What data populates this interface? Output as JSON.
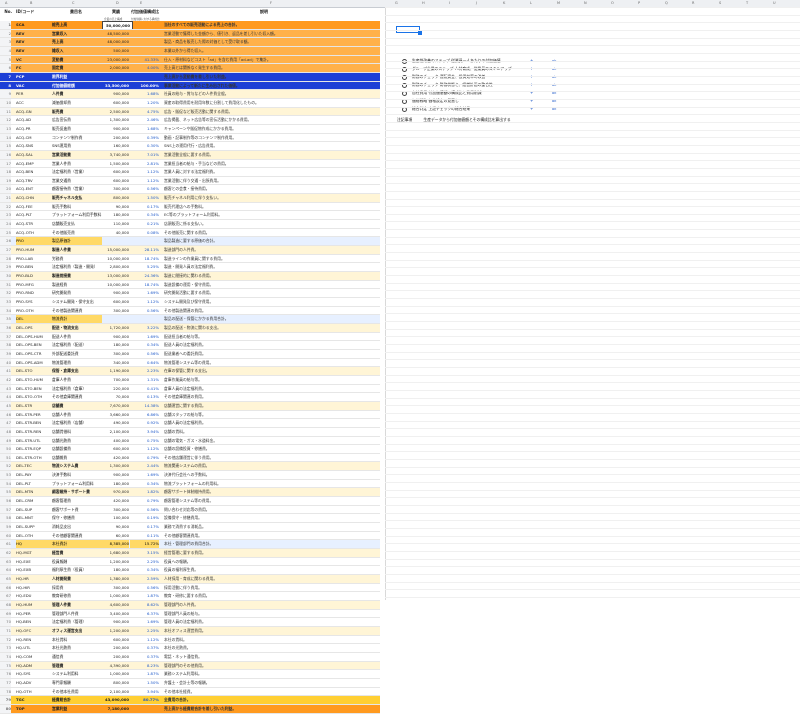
{
  "column_letters": [
    "A",
    "B",
    "C",
    "D",
    "E",
    "F",
    "G",
    "H",
    "I",
    "J",
    "K",
    "L",
    "M",
    "N",
    "O",
    "P",
    "Q",
    "R",
    "S",
    "T",
    "U"
  ],
  "headers": {
    "no": "No.",
    "code": "ID/コード",
    "name": "費目名",
    "value": "実績",
    "ratio": "付加価値構成比",
    "desc": "説明"
  },
  "subheaders": {
    "value_note": "企業の売上構成",
    "ratio_note": "付加価値に対する構成比"
  },
  "rows": [
    {
      "no": "1",
      "code": "SCA",
      "name": "総売上高",
      "value": "50,000,000",
      "ratio": "",
      "desc": "当社のすべての販売活動による売上の合計。",
      "style": "top"
    },
    {
      "no": "2",
      "code": "REV",
      "name": "営業収入",
      "value": "48,500,000",
      "ratio": "",
      "desc": "営業活動で獲得した金額から、値引き、返品を差し引いた収入額。",
      "style": "sales"
    },
    {
      "no": "3",
      "code": "REV",
      "name": "売上高",
      "value": "48,000,000",
      "ratio": "",
      "desc": "製品・商品を販売した際の対価として受け取る額。",
      "style": "sales"
    },
    {
      "no": "4",
      "code": "REV",
      "name": "雑収入",
      "value": "500,000",
      "ratio": "",
      "desc": "本業以外から得た収入。",
      "style": "sales"
    },
    {
      "no": "5",
      "code": "VC",
      "name": "変動費",
      "value": "23,000,000",
      "ratio": "41.33%",
      "desc": "仕入・原材料などコスト「ad」を含む費用「ad-ad」で集計。",
      "style": "sales"
    },
    {
      "no": "6",
      "code": "FC",
      "name": "固定費",
      "value": "2,000,000",
      "ratio": "4.00%",
      "desc": "売上高とは関係なく発生する費用。",
      "style": "sales"
    },
    {
      "no": "7",
      "code": "PCP",
      "name": "限界利益",
      "value": "",
      "ratio": "",
      "desc": "売上高から変動費を差し引いた利益。",
      "style": "blue"
    },
    {
      "no": "8",
      "code": "VAC",
      "name": "付加価値総額",
      "value": "33,500,000",
      "ratio": "100.00%",
      "desc": "事業活動によって新たに生み出された価値。",
      "style": "blue"
    },
    {
      "no": "9",
      "code": "PER",
      "name": "人件費",
      "value": "900,000",
      "ratio": "1.68%",
      "desc": "社員の給与・賞与などの人件費全般。",
      "style": "cat"
    },
    {
      "no": "10",
      "code": "ACC",
      "name": "減価償却費",
      "value": "600,000",
      "ratio": "1.20%",
      "desc": "資産の取得費用を耐用年数に分割して費用化したもの。",
      "style": "sub2"
    },
    {
      "no": "11",
      "code": "ACQ-GN",
      "name": "販売費",
      "value": "2,500,000",
      "ratio": "4.75%",
      "desc": "広告・販促など販売活動に関する費用。",
      "style": "cat"
    },
    {
      "no": "12",
      "code": "ACQ-AD",
      "name": "広告宣伝費",
      "value": "1,300,000",
      "ratio": "2.46%",
      "desc": "広告掲載、ネット広告等の宣伝活動にかかる費用。",
      "style": "sub2"
    },
    {
      "no": "13",
      "code": "ACQ-PR",
      "name": "販売促進費",
      "value": "900,000",
      "ratio": "1.68%",
      "desc": "キャンペーンや販促物作成にかかる費用。",
      "style": "sub2"
    },
    {
      "no": "14",
      "code": "ACQ-CM",
      "name": "コンテンツ制作費",
      "value": "200,000",
      "ratio": "0.39%",
      "desc": "動画・記事制作等のコンテンツ制作費用。",
      "style": "sub2"
    },
    {
      "no": "15",
      "code": "ACQ-SNS",
      "name": "SNS運用費",
      "value": "160,000",
      "ratio": "0.30%",
      "desc": "SNS上の運用代行・広告費用。",
      "style": "sub2"
    },
    {
      "no": "16",
      "code": "ACQ-SAL",
      "name": "営業活動費",
      "value": "3,740,000",
      "ratio": "7.01%",
      "desc": "営業活動全般に要する費用。",
      "style": "cat"
    },
    {
      "no": "17",
      "code": "ACQ-EMP",
      "name": "営業人件費",
      "value": "1,500,000",
      "ratio": "2.81%",
      "desc": "営業担当者の給与・手当などの費用。",
      "style": "sub2"
    },
    {
      "no": "18",
      "code": "ACQ-BEN",
      "name": "法定福利費（営業）",
      "value": "600,000",
      "ratio": "1.12%",
      "desc": "営業人員に対する法定福利費。",
      "style": "sub2"
    },
    {
      "no": "19",
      "code": "ACQ-TRV",
      "name": "営業交通費",
      "value": "600,000",
      "ratio": "1.12%",
      "desc": "営業活動に伴う交通・出張費用。",
      "style": "sub2"
    },
    {
      "no": "20",
      "code": "ACQ-ENT",
      "name": "顧客接待費（営業）",
      "value": "300,000",
      "ratio": "0.56%",
      "desc": "顧客との会食・接待費用。",
      "style": "sub2"
    },
    {
      "no": "21",
      "code": "ACQ-CHN",
      "name": "販売チャネル支払",
      "value": "800,000",
      "ratio": "1.50%",
      "desc": "販売チャネル利用に伴う支払い。",
      "style": "cat"
    },
    {
      "no": "22",
      "code": "ACQ-FEE",
      "name": "販売手数料",
      "value": "90,000",
      "ratio": "0.17%",
      "desc": "販売代理店への手数料。",
      "style": "sub2"
    },
    {
      "no": "23",
      "code": "ACQ-PLT",
      "name": "プラットフォーム利用手数料",
      "value": "180,000",
      "ratio": "0.34%",
      "desc": "EC等のプラットフォーム利用料。",
      "style": "sub2"
    },
    {
      "no": "24",
      "code": "ACQ-STR",
      "name": "店舗販売支払",
      "value": "110,000",
      "ratio": "0.21%",
      "desc": "店頭販売に係る支払い。",
      "style": "sub2"
    },
    {
      "no": "25",
      "code": "ACQ-OTH",
      "name": "その他販売費",
      "value": "40,000",
      "ratio": "0.08%",
      "desc": "その他販売に関する費用。",
      "style": "sub2"
    },
    {
      "no": "26",
      "code": "PRO",
      "name": "製品原価計",
      "value": "",
      "ratio": "",
      "desc": "製品製造に要する原価の合計。",
      "style": "gold"
    },
    {
      "no": "27",
      "code": "PRO-HUM",
      "name": "製造人件費",
      "value": "15,000,000",
      "ratio": "28.11%",
      "desc": "製造部門の人件費。",
      "style": "cat"
    },
    {
      "no": "28",
      "code": "PRO-LAB",
      "name": "労務費",
      "value": "10,000,000",
      "ratio": "18.74%",
      "desc": "製造ラインの作業員に関する費用。",
      "style": "sub2"
    },
    {
      "no": "29",
      "code": "PRO-BEN",
      "name": "法定福利費（製造・開発）",
      "value": "2,800,000",
      "ratio": "5.25%",
      "desc": "製造・開発人員の法定福利費。",
      "style": "sub2"
    },
    {
      "no": "30",
      "code": "PRO-BLD",
      "name": "製造間接費",
      "value": "13,000,000",
      "ratio": "24.36%",
      "desc": "製造に間接的に関わる費用。",
      "style": "cat"
    },
    {
      "no": "31",
      "code": "PRO-MFG",
      "name": "製造経費",
      "value": "10,000,000",
      "ratio": "18.74%",
      "desc": "製造設備の運用・保守費用。",
      "style": "sub2"
    },
    {
      "no": "32",
      "code": "PRO-RND",
      "name": "研究開発費",
      "value": "900,000",
      "ratio": "1.69%",
      "desc": "研究開発活動に要する費用。",
      "style": "sub2"
    },
    {
      "no": "33",
      "code": "PRO-SYS",
      "name": "システム開発・保守支出",
      "value": "600,000",
      "ratio": "1.12%",
      "desc": "システム開発及び保守費用。",
      "style": "sub2"
    },
    {
      "no": "34",
      "code": "PRO-OTH",
      "name": "その他製造関連費",
      "value": "300,000",
      "ratio": "0.56%",
      "desc": "その他製造関連の費用。",
      "style": "sub2"
    },
    {
      "no": "35",
      "code": "DEL",
      "name": "物流費計",
      "value": "",
      "ratio": "",
      "desc": "製品の配送・保管にかかる費用合計。",
      "style": "gold"
    },
    {
      "no": "36",
      "code": "DEL-OPS",
      "name": "配送・物流支出",
      "value": "1,720,000",
      "ratio": "3.22%",
      "desc": "製品の配送・物流に関わる支出。",
      "style": "cat"
    },
    {
      "no": "37",
      "code": "DEL-OPS-HUM",
      "name": "配送人件費",
      "value": "900,000",
      "ratio": "1.69%",
      "desc": "配送担当者の給与等。",
      "style": "sub2"
    },
    {
      "no": "38",
      "code": "DEL-OPS-BEN",
      "name": "法定福利費（配送）",
      "value": "180,000",
      "ratio": "0.34%",
      "desc": "配送人員の法定福利費。",
      "style": "sub2"
    },
    {
      "no": "39",
      "code": "DEL-OPS-CTR",
      "name": "外部配送委託費",
      "value": "300,000",
      "ratio": "0.56%",
      "desc": "配送業者への委託費用。",
      "style": "sub2"
    },
    {
      "no": "40",
      "code": "DEL-OPS-ADM",
      "name": "物流管理費",
      "value": "340,000",
      "ratio": "0.64%",
      "desc": "物流管理システム等の費用。",
      "style": "sub2"
    },
    {
      "no": "41",
      "code": "DEL-STO",
      "name": "保管・倉庫支出",
      "value": "1,190,000",
      "ratio": "2.23%",
      "desc": "在庫の保管に関する支出。",
      "style": "cat"
    },
    {
      "no": "42",
      "code": "DEL-STO-HUM",
      "name": "倉庫人件費",
      "value": "700,000",
      "ratio": "1.31%",
      "desc": "倉庫作業員の給与等。",
      "style": "sub2"
    },
    {
      "no": "43",
      "code": "DEL-STO-BEN",
      "name": "法定福利費（倉庫）",
      "value": "220,000",
      "ratio": "0.41%",
      "desc": "倉庫人員の法定福利費。",
      "style": "sub2"
    },
    {
      "no": "44",
      "code": "DEL-STO-OTH",
      "name": "その他倉庫関連費",
      "value": "70,000",
      "ratio": "0.13%",
      "desc": "その他倉庫関連の費用。",
      "style": "sub2"
    },
    {
      "no": "45",
      "code": "DEL-STR",
      "name": "店舗費",
      "value": "7,670,000",
      "ratio": "14.38%",
      "desc": "店舗運営に関する費用。",
      "style": "cat"
    },
    {
      "no": "46",
      "code": "DEL-STR-PER",
      "name": "店舗人件費",
      "value": "3,660,000",
      "ratio": "6.86%",
      "desc": "店舗スタッフの給与等。",
      "style": "sub2"
    },
    {
      "no": "47",
      "code": "DEL-STR-BEN",
      "name": "法定福利費（店舗）",
      "value": "490,000",
      "ratio": "0.92%",
      "desc": "店舗人員の法定福利費。",
      "style": "sub2"
    },
    {
      "no": "48",
      "code": "DEL-STR-REN",
      "name": "店舗賃借料",
      "value": "2,100,000",
      "ratio": "3.94%",
      "desc": "店舗の賃料。",
      "style": "sub2"
    },
    {
      "no": "49",
      "code": "DEL-STR-UTL",
      "name": "店舗光熱費",
      "value": "400,000",
      "ratio": "0.75%",
      "desc": "店舗の電気・ガス・水道料金。",
      "style": "sub2"
    },
    {
      "no": "50",
      "code": "DEL-STR-EQP",
      "name": "店舗設備費",
      "value": "600,000",
      "ratio": "1.12%",
      "desc": "店舗の設備投資・修繕費。",
      "style": "sub2"
    },
    {
      "no": "51",
      "code": "DEL-STR-OTH",
      "name": "店舗雑費",
      "value": "420,000",
      "ratio": "0.79%",
      "desc": "その他店舗運営に伴う費用。",
      "style": "sub2"
    },
    {
      "no": "52",
      "code": "DEL-TEC",
      "name": "物流システム費",
      "value": "1,300,000",
      "ratio": "2.44%",
      "desc": "物流関連システムの費用。",
      "style": "cat"
    },
    {
      "no": "53",
      "code": "DEL-PAY",
      "name": "決済手数料",
      "value": "900,000",
      "ratio": "1.69%",
      "desc": "決済代行会社への手数料。",
      "style": "sub2"
    },
    {
      "no": "54",
      "code": "DEL-PLT",
      "name": "プラットフォーム利用料",
      "value": "180,000",
      "ratio": "0.34%",
      "desc": "物流プラットフォームの利用料。",
      "style": "sub2"
    },
    {
      "no": "55",
      "code": "DEL-MTN",
      "name": "顧客維持・サポート費",
      "value": "970,000",
      "ratio": "1.82%",
      "desc": "顧客サポート体制維持費用。",
      "style": "cat"
    },
    {
      "no": "56",
      "code": "DEL-CRM",
      "name": "顧客管理費",
      "value": "420,000",
      "ratio": "0.79%",
      "desc": "顧客管理システム等の費用。",
      "style": "sub2"
    },
    {
      "no": "57",
      "code": "DEL-SUP",
      "name": "顧客サポート費",
      "value": "300,000",
      "ratio": "0.56%",
      "desc": "問い合わせ対応等の費用。",
      "style": "sub2"
    },
    {
      "no": "58",
      "code": "DEL-MNT",
      "name": "保守・修繕費",
      "value": "100,000",
      "ratio": "0.19%",
      "desc": "設備保守・修繕費用。",
      "style": "sub2"
    },
    {
      "no": "59",
      "code": "DEL-SUPP",
      "name": "消耗品支出",
      "value": "90,000",
      "ratio": "0.17%",
      "desc": "業務で消費する消耗品。",
      "style": "sub2"
    },
    {
      "no": "60",
      "code": "DEL-OTH",
      "name": "その他顧客関連費",
      "value": "60,000",
      "ratio": "0.11%",
      "desc": "その他顧客関連費用。",
      "style": "sub2"
    },
    {
      "no": "61",
      "code": "HQ",
      "name": "本社費計",
      "value": "8,385,000",
      "ratio": "15.72%",
      "desc": "本社・管理部門の費用合計。",
      "style": "gold"
    },
    {
      "no": "62",
      "code": "HQ-MGT",
      "name": "経営費",
      "value": "1,680,000",
      "ratio": "3.15%",
      "desc": "経営管理に要する費用。",
      "style": "cat"
    },
    {
      "no": "63",
      "code": "HQ-EXE",
      "name": "役員報酬",
      "value": "1,200,000",
      "ratio": "2.25%",
      "desc": "役員への報酬。",
      "style": "sub2"
    },
    {
      "no": "64",
      "code": "HQ-EXB",
      "name": "福利厚生費（役員）",
      "value": "180,000",
      "ratio": "0.34%",
      "desc": "役員の福利厚生費。",
      "style": "sub2"
    },
    {
      "no": "65",
      "code": "HQ-HR",
      "name": "人材開発費",
      "value": "1,380,000",
      "ratio": "2.59%",
      "desc": "人材採用・育成に関わる費用。",
      "style": "cat"
    },
    {
      "no": "66",
      "code": "HQ-HIR",
      "name": "採用費",
      "value": "300,000",
      "ratio": "0.56%",
      "desc": "採用活動に伴う費用。",
      "style": "sub2"
    },
    {
      "no": "67",
      "code": "HQ-EDU",
      "name": "教育研修費",
      "value": "1,000,000",
      "ratio": "1.87%",
      "desc": "教育・研修に要する費用。",
      "style": "sub2"
    },
    {
      "no": "68",
      "code": "HQ-HUM",
      "name": "管理人件費",
      "value": "4,600,000",
      "ratio": "8.62%",
      "desc": "管理部門の人件費。",
      "style": "cat"
    },
    {
      "no": "69",
      "code": "HQ-PER",
      "name": "管理部門人件費",
      "value": "3,400,000",
      "ratio": "6.37%",
      "desc": "管理部門人員の給与。",
      "style": "sub2"
    },
    {
      "no": "70",
      "code": "HQ-BEN",
      "name": "法定福利費（管理）",
      "value": "900,000",
      "ratio": "1.69%",
      "desc": "管理人員の法定福利費。",
      "style": "sub2"
    },
    {
      "no": "71",
      "code": "HQ-OFC",
      "name": "オフィス運営支出",
      "value": "1,200,000",
      "ratio": "2.25%",
      "desc": "本社オフィス運営費用。",
      "style": "cat"
    },
    {
      "no": "72",
      "code": "HQ-REN",
      "name": "本社賃料",
      "value": "600,000",
      "ratio": "1.12%",
      "desc": "本社の賃料。",
      "style": "sub2"
    },
    {
      "no": "73",
      "code": "HQ-UTL",
      "name": "本社光熱費",
      "value": "200,000",
      "ratio": "0.37%",
      "desc": "本社の光熱費。",
      "style": "sub2"
    },
    {
      "no": "74",
      "code": "HQ-COM",
      "name": "通信費",
      "value": "200,000",
      "ratio": "0.37%",
      "desc": "電話・ネット通信費。",
      "style": "sub2"
    },
    {
      "no": "75",
      "code": "HQ-ADM",
      "name": "管理費",
      "value": "4,390,000",
      "ratio": "8.23%",
      "desc": "管理部門のその他費用。",
      "style": "cat"
    },
    {
      "no": "76",
      "code": "HQ-SYS",
      "name": "システム利用料",
      "value": "1,000,000",
      "ratio": "1.87%",
      "desc": "業務システム利用料。",
      "style": "sub2"
    },
    {
      "no": "77",
      "code": "HQ-ADV",
      "name": "専門家報酬",
      "value": "800,000",
      "ratio": "1.50%",
      "desc": "弁護士・会計士等の報酬。",
      "style": "sub2"
    },
    {
      "no": "78",
      "code": "HQ-OTH",
      "name": "その他本社費用",
      "value": "2,100,000",
      "ratio": "3.94%",
      "desc": "その他本社経費。",
      "style": "sub2"
    },
    {
      "no": "79",
      "code": "TGC",
      "name": "経費総合計",
      "value": "43,090,000",
      "ratio": "80.77%",
      "desc": "全費用の合計。",
      "style": "total"
    },
    {
      "no": "80",
      "code": "TOP",
      "name": "営業利益",
      "value": "7,180,000",
      "ratio": "",
      "desc": "売上高から経費総合計を差し引いた利益。",
      "style": "top"
    }
  ],
  "legend": {
    "items": [
      {
        "label": "生産性改善のステップ 従業員一人あたりの付加価値",
        "mark": "+",
        "link": "ok"
      },
      {
        "label": "グループ企業のステップ 人材育成、従業員のスキルアップ",
        "mark": "+",
        "link": "ok"
      },
      {
        "label": "財務のチェック 運転資金、投資効率の改善",
        "mark": "+",
        "link": "ok"
      },
      {
        "label": "財務のチェック 財務状態と、経営計画の整合性",
        "mark": "+",
        "link": "ok"
      },
      {
        "label": "自社費用 付加価値額の構成比と費用削減",
        "mark": "+",
        "link": "ok"
      },
      {
        "label": "価格戦略 価格設定の見直し",
        "mark": "+",
        "link": "ok"
      },
      {
        "label": "総合判定 上記チェックの総合結果",
        "mark": "+",
        "link": "ok"
      }
    ]
  },
  "note": {
    "label": "注記事項",
    "text": "生産データから付加価値額とその構成比を算出する"
  }
}
